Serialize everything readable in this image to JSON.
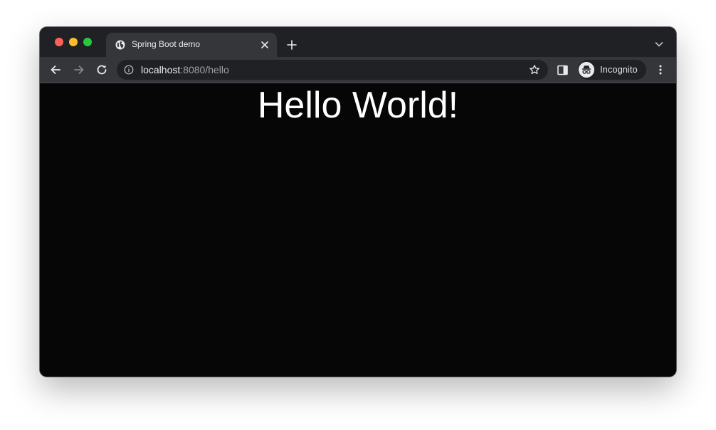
{
  "window": {
    "controls": [
      "close",
      "minimize",
      "maximize"
    ]
  },
  "tab": {
    "title": "Spring Boot demo",
    "favicon": "globe-icon"
  },
  "toolbar": {
    "url_host": "localhost",
    "url_rest": ":8080/hello",
    "profile_label": "Incognito"
  },
  "page": {
    "heading": "Hello World!"
  },
  "colors": {
    "chrome_frame": "#202124",
    "toolbar": "#35363a",
    "page_background": "#060606",
    "text": "#e8eaed",
    "dim_text": "#9aa0a6"
  }
}
